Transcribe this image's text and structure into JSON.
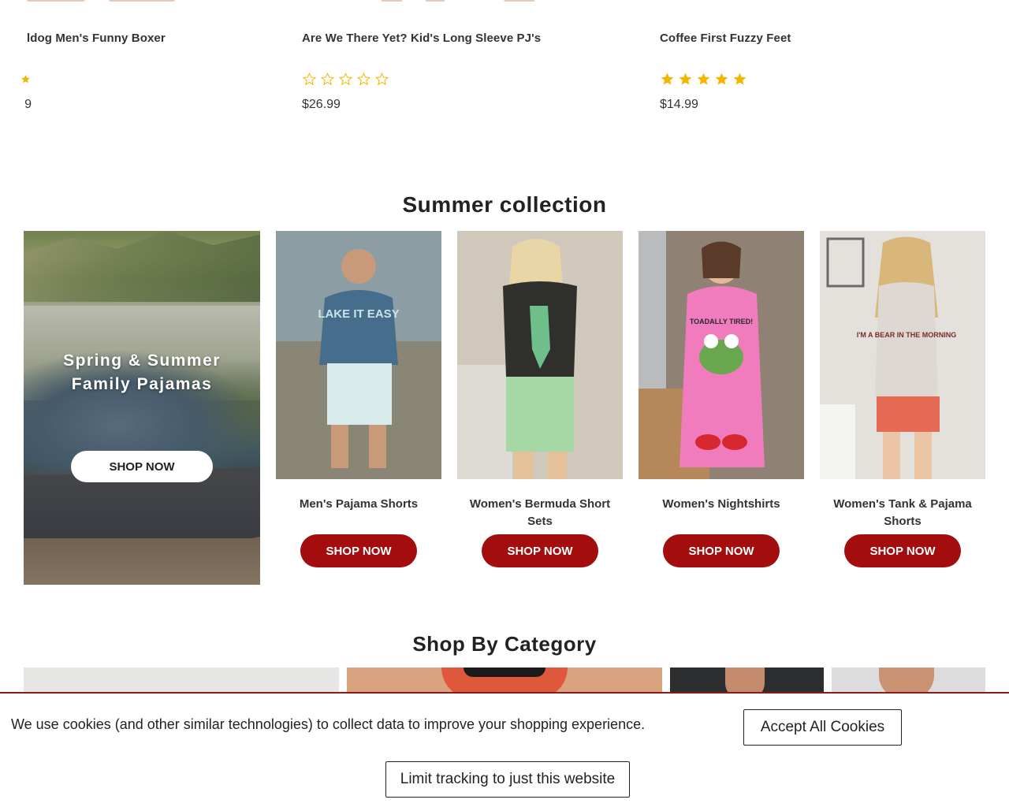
{
  "products": [
    {
      "name": "ldog Men's Funny Boxer",
      "rating": 5,
      "price": "9",
      "stars_visible": 1
    },
    {
      "name": "Are We There Yet? Kid's Long Sleeve PJ's",
      "rating": 0,
      "price": "$26.99"
    },
    {
      "name": "Coffee First Fuzzy Feet",
      "rating": 5,
      "price": "$14.99"
    }
  ],
  "summer": {
    "title": "Summer collection",
    "hero": {
      "title_line1": "Spring & Summer",
      "title_line2": "Family Pajamas",
      "button": "SHOP NOW"
    },
    "cards": [
      {
        "label": "Men's Pajama Shorts",
        "button": "SHOP NOW",
        "shirt_text": "LAKE IT EASY"
      },
      {
        "label": "Women's Bermuda Short Sets",
        "button": "SHOP NOW"
      },
      {
        "label": "Women's Nightshirts",
        "button": "SHOP NOW",
        "shirt_text": "TOADALLY TIRED!"
      },
      {
        "label": "Women's Tank & Pajama Shorts",
        "button": "SHOP NOW",
        "shirt_text": "I'M A BEAR IN THE MORNING"
      }
    ]
  },
  "category": {
    "title": "Shop By Category"
  },
  "cookie": {
    "text": "We use cookies (and other similar technologies) to collect data to improve your shopping experience.",
    "accept": "Accept All Cookies",
    "limit": "Limit tracking to just this website"
  },
  "colors": {
    "brand_red": "#a30d0d",
    "star_gold": "#f5b400",
    "banner_border": "#8b1a1a"
  }
}
